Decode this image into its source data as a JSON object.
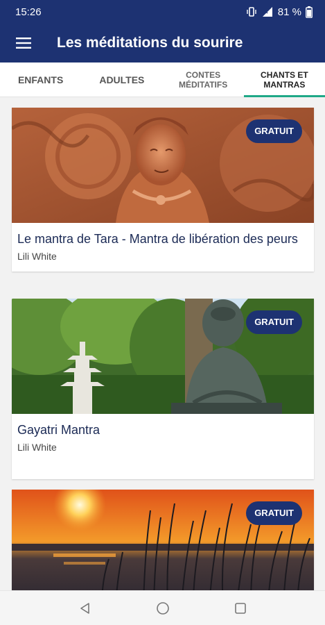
{
  "status_bar": {
    "time": "15:26",
    "battery": "81 %"
  },
  "app_bar": {
    "title": "Les méditations du sourire"
  },
  "tabs": [
    {
      "label": "ENFANTS",
      "active": false
    },
    {
      "label": "ADULTES",
      "active": false
    },
    {
      "label": "CONTES\nMÉDITATIFS",
      "active": false
    },
    {
      "label": "CHANTS ET\nMANTRAS",
      "active": true
    }
  ],
  "cards": [
    {
      "badge": "GRATUIT",
      "title": "Le mantra de Tara - Mantra de libération des peurs",
      "author": "Lili White",
      "image": "tara-statue-image"
    },
    {
      "badge": "GRATUIT",
      "title": "Gayatri Mantra",
      "author": "Lili White",
      "image": "buddha-garden-image"
    },
    {
      "badge": "GRATUIT",
      "image": "sunset-reeds-image"
    }
  ],
  "colors": {
    "primary": "#1d3272",
    "tab_indicator": "#1fa887",
    "badge": "#1d3272"
  },
  "icons": [
    "menu-icon",
    "vibrate-icon",
    "signal-icon",
    "battery-icon",
    "back-icon",
    "home-icon",
    "recents-icon"
  ]
}
